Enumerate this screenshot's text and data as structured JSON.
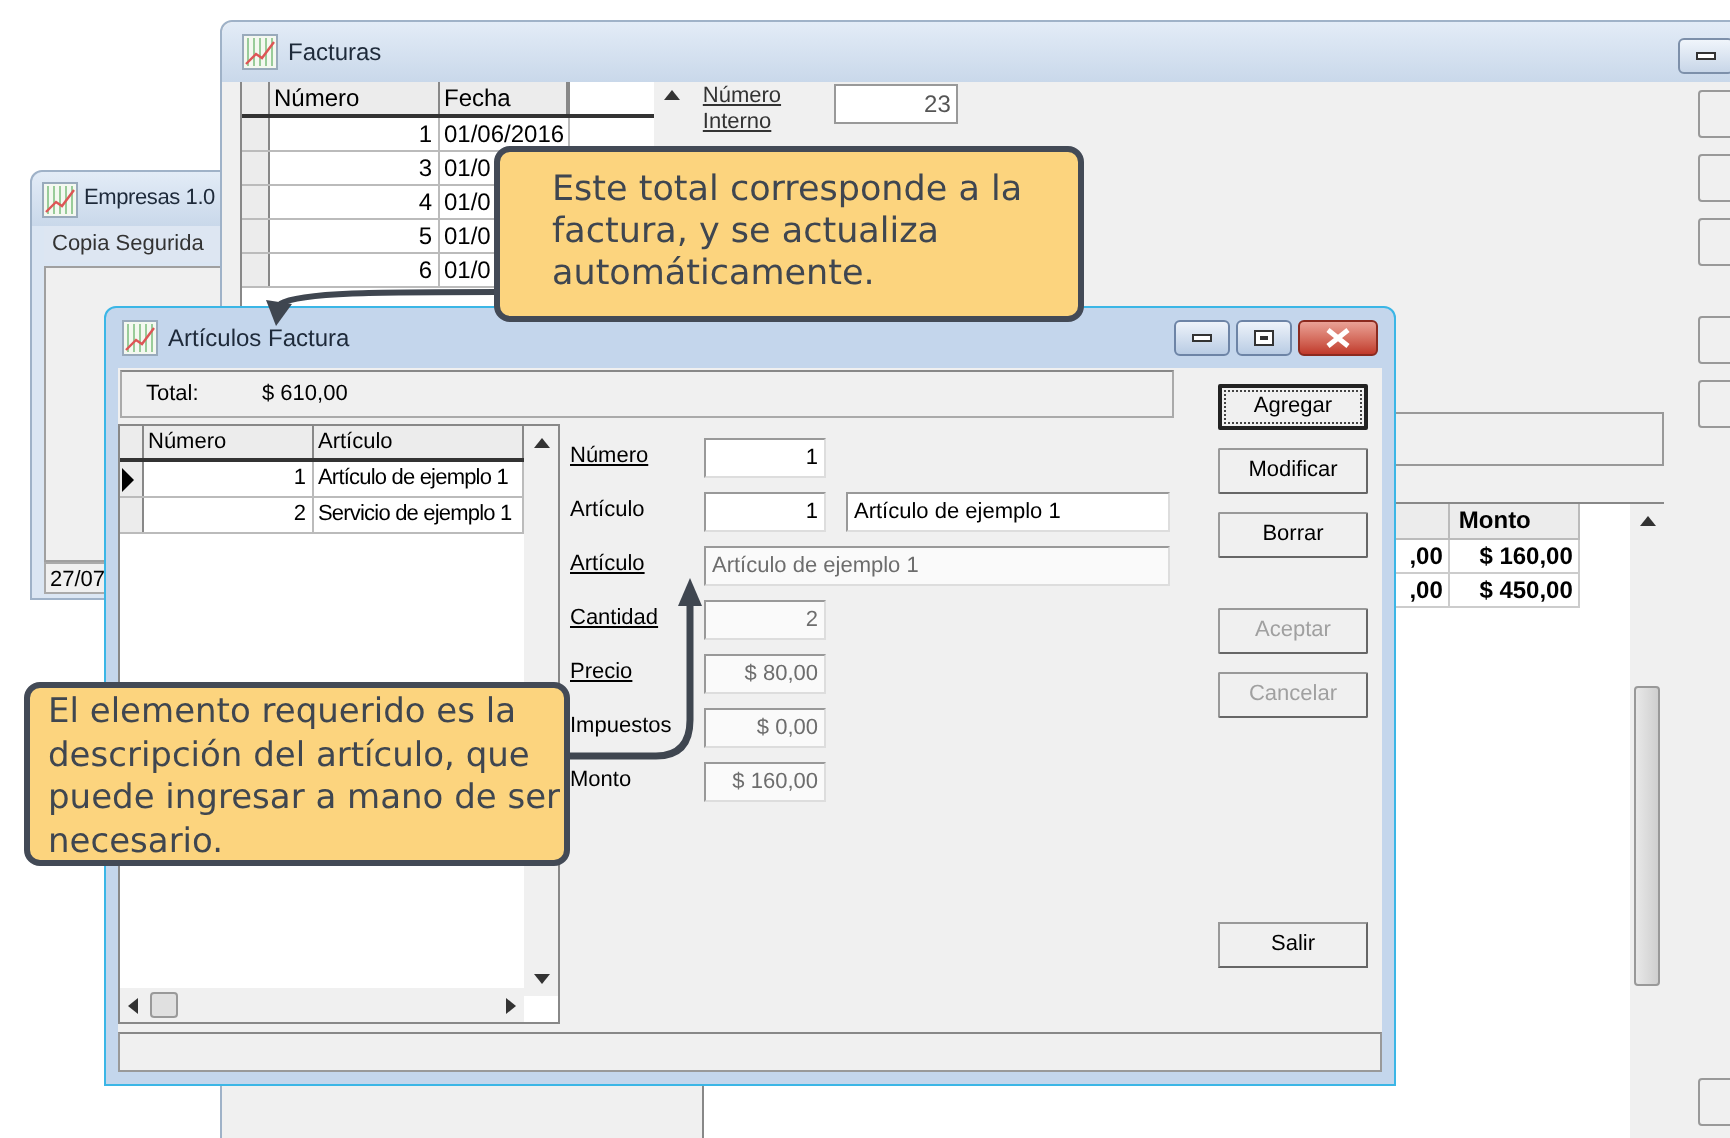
{
  "empresas_window": {
    "title": "Empresas 1.0",
    "menu": [
      "Copia Segurida"
    ],
    "status": "27/07"
  },
  "facturas_window": {
    "title": "Facturas",
    "table": {
      "columns": [
        "Número",
        "Fecha"
      ],
      "rows": [
        {
          "cells": [
            "1",
            "01/06/2016"
          ]
        },
        {
          "cells": [
            "3",
            "01/0"
          ]
        },
        {
          "cells": [
            "4",
            "01/0"
          ]
        },
        {
          "cells": [
            "5",
            "01/0"
          ]
        },
        {
          "cells": [
            "6",
            "01/0"
          ]
        }
      ]
    },
    "fields": [
      {
        "label": "Número Interno",
        "value": "23",
        "kind": "number"
      }
    ],
    "detail_table": {
      "columns": [
        "",
        "Monto"
      ],
      "rows": [
        {
          "cells": [
            ",00",
            "$ 160,00"
          ]
        },
        {
          "cells": [
            ",00",
            "$ 450,00"
          ]
        }
      ]
    }
  },
  "articulos_window": {
    "title": "Artículos Factura",
    "total_label": "Total:",
    "total_value": "$ 610,00",
    "table": {
      "columns": [
        "Número",
        "Artículo"
      ],
      "rows": [
        {
          "cells": [
            "1",
            "Artículo de ejemplo 1"
          ],
          "selected": true
        },
        {
          "cells": [
            "2",
            "Servicio de ejemplo 1"
          ],
          "selected": false
        }
      ]
    },
    "fields": [
      {
        "label": "Número",
        "underlined": true,
        "values": [
          "1"
        ],
        "disabled": false,
        "kind": "number"
      },
      {
        "label": "Artículo",
        "underlined": false,
        "values": [
          "1",
          "Artículo de ejemplo 1"
        ],
        "disabled": false,
        "kind": "pair"
      },
      {
        "label": "Artículo",
        "underlined": true,
        "values": [
          "Artículo de ejemplo 1"
        ],
        "disabled": true,
        "kind": "wide"
      },
      {
        "label": "Cantidad",
        "underlined": true,
        "values": [
          "2"
        ],
        "disabled": true,
        "kind": "number"
      },
      {
        "label": "Precio",
        "underlined": true,
        "values": [
          "$ 80,00"
        ],
        "disabled": true,
        "kind": "number"
      },
      {
        "label": "Impuestos",
        "underlined": false,
        "values": [
          "$ 0,00"
        ],
        "disabled": true,
        "kind": "number"
      },
      {
        "label": "Monto",
        "underlined": false,
        "values": [
          "$ 160,00"
        ],
        "disabled": true,
        "kind": "number"
      }
    ],
    "buttons": [
      {
        "label": "Agregar",
        "disabled": false,
        "focused": true
      },
      {
        "label": "Modificar",
        "disabled": false,
        "focused": false
      },
      {
        "label": "Borrar",
        "disabled": false,
        "focused": false
      },
      {
        "label": "Aceptar",
        "disabled": true,
        "focused": false
      },
      {
        "label": "Cancelar",
        "disabled": true,
        "focused": false
      }
    ],
    "exit_button": "Salir"
  },
  "callouts": [
    {
      "text": "Este total corresponde a la factura, y se actualiza automáticamente."
    },
    {
      "text": "El elemento requerido es la descripción del artículo, que puede ingresar a mano de ser necesario."
    }
  ]
}
